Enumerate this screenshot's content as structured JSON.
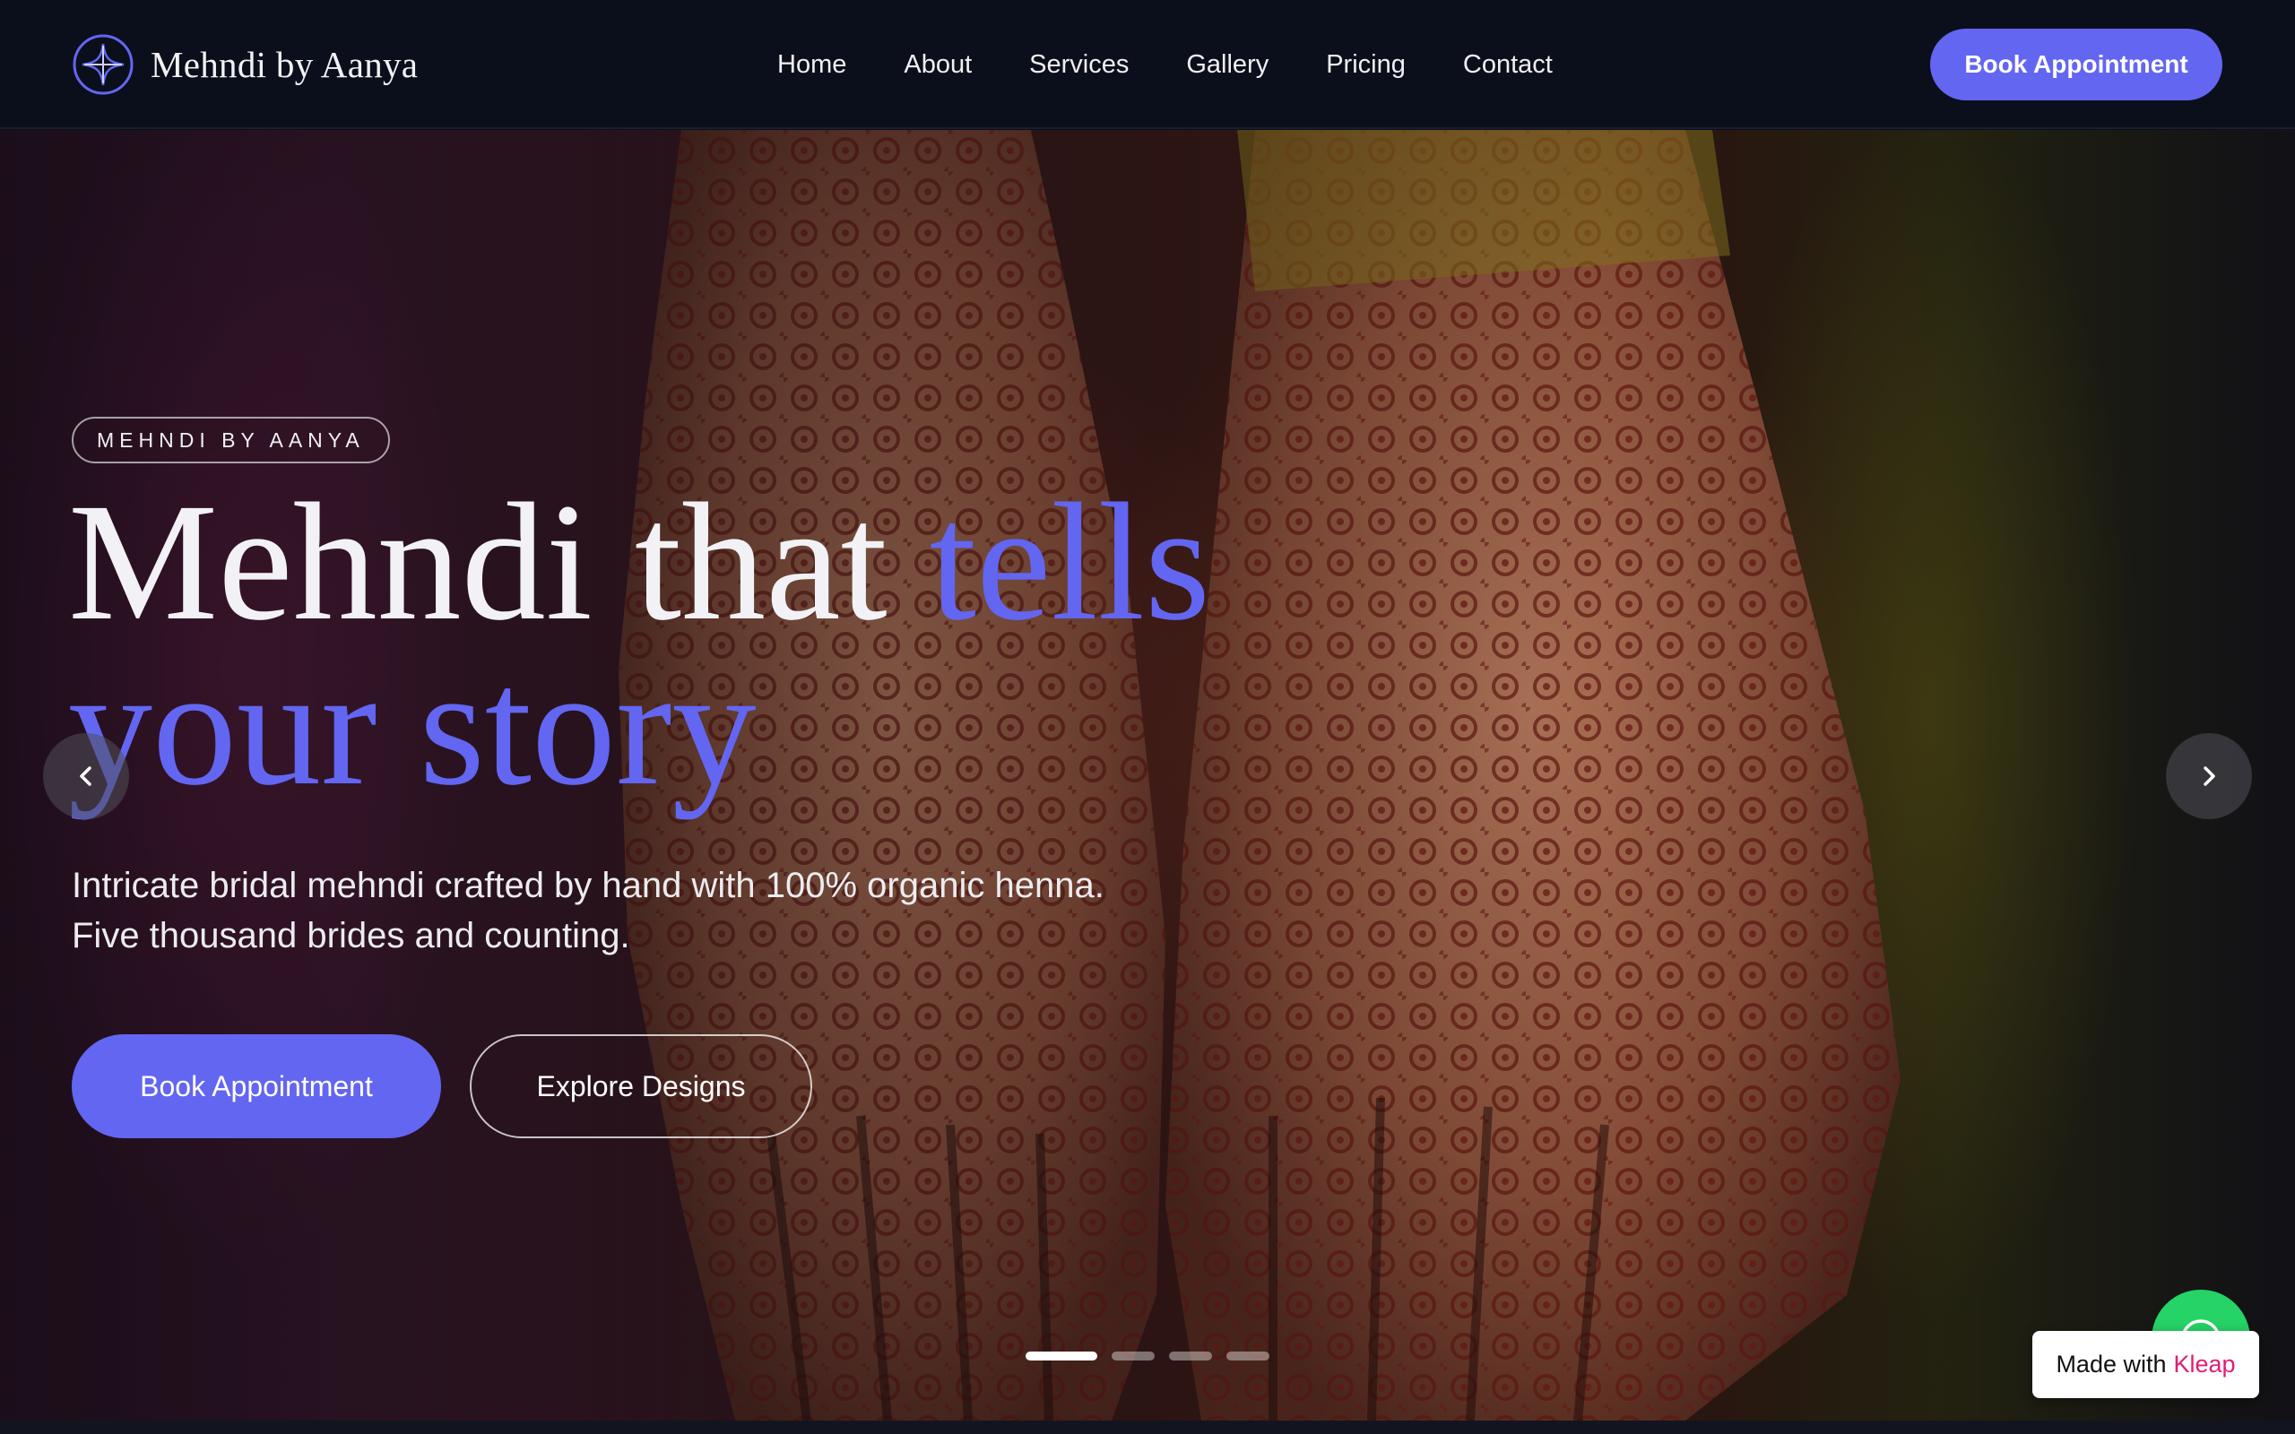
{
  "nav": {
    "brand": "Mehndi by Aanya",
    "logo_icon": "compass-star-icon",
    "links": [
      "Home",
      "About",
      "Services",
      "Gallery",
      "Pricing",
      "Contact"
    ],
    "cta": "Book Appointment"
  },
  "hero": {
    "eyebrow": "MEHNDI BY AANYA",
    "headline_part1": "Mehndi that ",
    "headline_accent1": "tells",
    "headline_accent2": "your story",
    "subheadline": "Intricate bridal mehndi crafted by hand with 100% organic henna. Five thousand brides and counting.",
    "primary_cta": "Book Appointment",
    "secondary_cta": "Explore Designs",
    "prev_icon": "chevron-left-icon",
    "next_icon": "chevron-right-icon",
    "slide_count": 4,
    "active_slide": 1
  },
  "floating": {
    "whatsapp_icon": "whatsapp-icon",
    "made_with": "Made with",
    "made_with_brand": "Kleap"
  },
  "colors": {
    "accent": "#6366f1",
    "nav_bg": "#0b0f1b",
    "whatsapp": "#25d366",
    "kleap": "#e11d74"
  }
}
